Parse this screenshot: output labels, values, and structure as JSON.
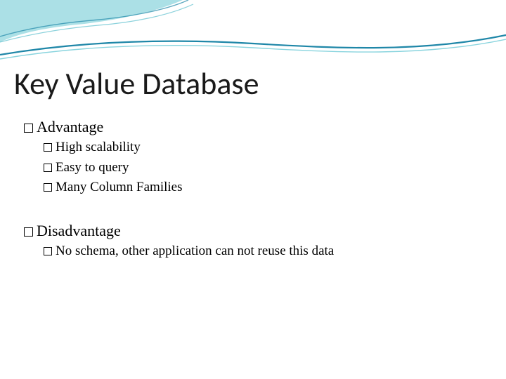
{
  "title": "Key Value Database",
  "sections": [
    {
      "heading": "Advantage",
      "items": [
        "High scalability",
        "Easy to query",
        "Many Column Families"
      ]
    },
    {
      "heading": "Disadvantage",
      "items": [
        "No schema, other application can not reuse this data"
      ]
    }
  ]
}
